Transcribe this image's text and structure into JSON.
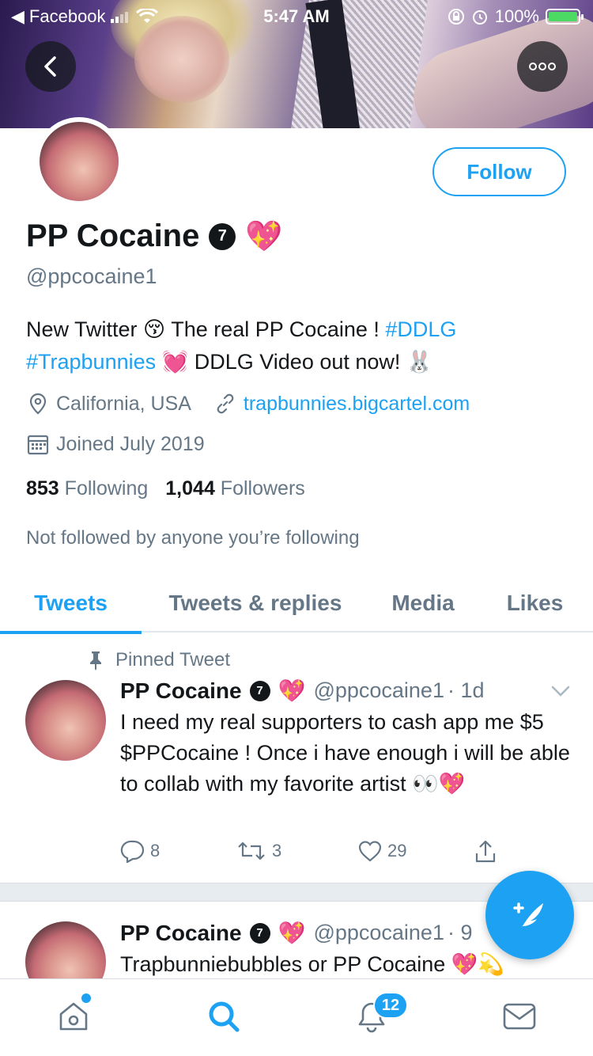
{
  "status_bar": {
    "back_app": "Facebook",
    "time": "5:47 AM",
    "battery": "100%"
  },
  "profile": {
    "name": "PP Cocaine",
    "badge": "7",
    "name_emoji": "💖",
    "handle": "@ppcocaine1",
    "follow_label": "Follow",
    "bio": {
      "part1": "New Twitter ",
      "emoji1": "😚",
      "part2": " The real PP Cocaine ! ",
      "hashtag1": "#DDLG",
      "hashtag2": "#Trapbunnies",
      "emoji2": "💓",
      "part3": " DDLG Video out now! ",
      "emoji3": "🐰"
    },
    "location": "California, USA",
    "website": "trapbunnies.bigcartel.com",
    "joined": "Joined July 2019",
    "following_count": "853",
    "following_label": "Following",
    "followers_count": "1,044",
    "followers_label": "Followers",
    "not_followed": "Not followed by anyone you’re following"
  },
  "tabs": [
    {
      "label": "Tweets",
      "active": true
    },
    {
      "label": "Tweets & replies",
      "active": false
    },
    {
      "label": "Media",
      "active": false
    },
    {
      "label": "Likes",
      "active": false
    }
  ],
  "tweets": [
    {
      "pinned_label": "Pinned Tweet",
      "name": "PP Cocaine",
      "badge": "7",
      "emoji": "💖",
      "handle": "@ppcocaine1",
      "time": "· 1d",
      "text": "I need my real supporters to cash app me $5 $PPCocaine ! Once i have enough i will be able to collab with my favorite artist 👀💖",
      "replies": "8",
      "retweets": "3",
      "likes": "29"
    },
    {
      "name": "PP Cocaine",
      "badge": "7",
      "emoji": "💖",
      "handle": "@ppcocaine1",
      "time": "· 9",
      "text": "Trapbunniebubbles or PP Cocaine 💖💫"
    }
  ],
  "bottom_nav": {
    "notifications_count": "12"
  },
  "icons": [
    "back-arrow-icon",
    "more-icon",
    "location-pin-icon",
    "link-icon",
    "calendar-icon",
    "pin-icon",
    "chevron-down-icon",
    "reply-icon",
    "retweet-icon",
    "like-icon",
    "share-icon",
    "compose-icon",
    "home-icon",
    "search-icon",
    "bell-icon",
    "mail-icon"
  ],
  "colors": {
    "accent": "#1da1f2",
    "text": "#14171a",
    "secondary": "#657786"
  }
}
